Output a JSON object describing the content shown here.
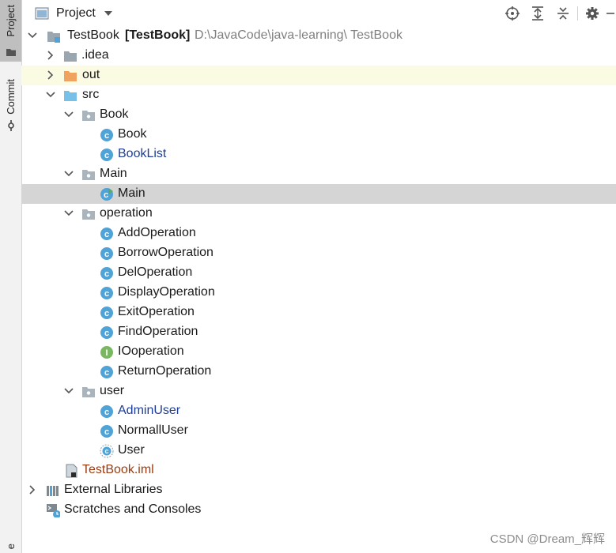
{
  "side_tabs": {
    "project": "Project",
    "commit": "Commit",
    "bottom": "e"
  },
  "header": {
    "title": "Project"
  },
  "tree": {
    "root": {
      "name": "TestBook",
      "module": "[TestBook]",
      "path": "D:\\JavaCode\\java-learning\\ TestBook"
    },
    "idea": ".idea",
    "out": "out",
    "src": "src",
    "pkg_book": "Book",
    "cls_book": "Book",
    "cls_booklist": "BookList",
    "pkg_main": "Main",
    "cls_main": "Main",
    "pkg_operation": "operation",
    "ops": [
      "AddOperation",
      "BorrowOperation",
      "DelOperation",
      "DisplayOperation",
      "ExitOperation",
      "FindOperation",
      "IOoperation",
      "ReturnOperation"
    ],
    "pkg_user": "user",
    "users": [
      "AdminUser",
      "NormallUser",
      "User"
    ],
    "iml": "TestBook.iml",
    "ext_libs": "External Libraries",
    "scratches": "Scratches and Consoles"
  },
  "watermark": "CSDN @Dream_辉辉",
  "colors": {
    "selection": "#d5d5d5",
    "highlight_row": "#fbfbe4",
    "class_icon": "#4fa3d6",
    "interface_icon": "#7bb661",
    "folder": "#9aa7b0",
    "excluded_folder": "#f0a35e",
    "src_folder": "#77c0e8",
    "blue_text": "#1d3d9b",
    "modified_text": "#9c3b0f"
  }
}
